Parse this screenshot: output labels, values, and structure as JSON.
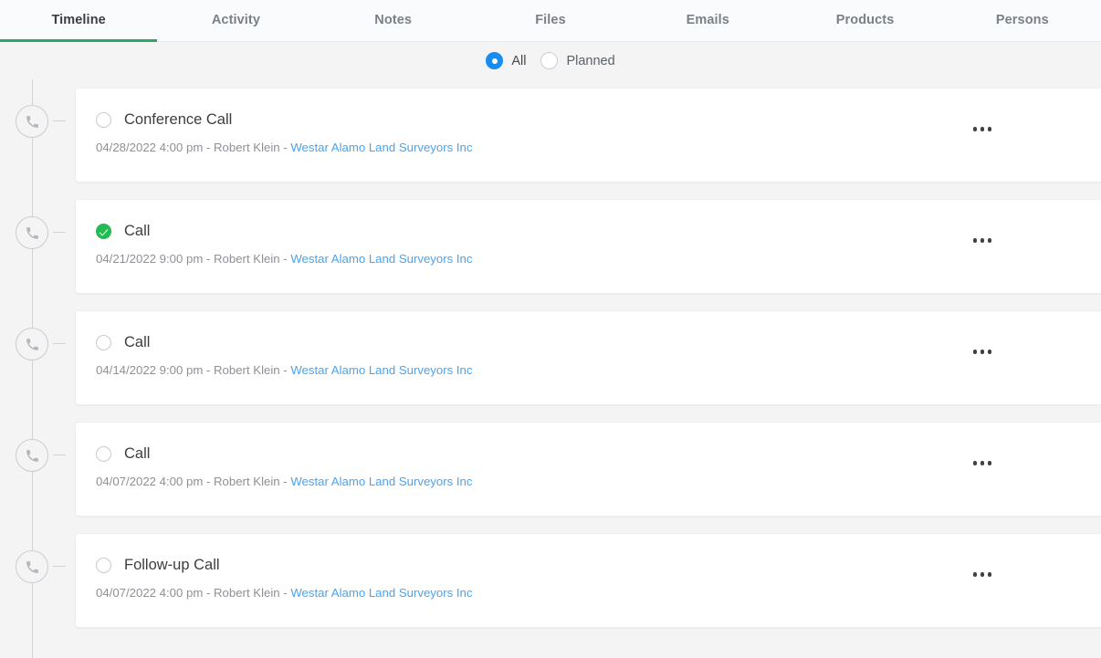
{
  "tabs": [
    {
      "label": "Timeline",
      "active": true
    },
    {
      "label": "Activity",
      "active": false
    },
    {
      "label": "Notes",
      "active": false
    },
    {
      "label": "Files",
      "active": false
    },
    {
      "label": "Emails",
      "active": false
    },
    {
      "label": "Products",
      "active": false
    },
    {
      "label": "Persons",
      "active": false
    }
  ],
  "filter": {
    "all_label": "All",
    "planned_label": "Planned",
    "selected": "All"
  },
  "colors": {
    "active_tab_underline": "#2ea664",
    "radio_selected": "#1a8cf0",
    "link": "#4aa3f0",
    "status_done": "#21ba53",
    "page_background": "#f4f4f4",
    "card_background": "#ffffff"
  },
  "timeline": {
    "icon": "phone-icon",
    "menu_icon": "kebab-menu-icon",
    "items": [
      {
        "title": "Conference Call",
        "status": "open",
        "date": "04/28/2022 4:00 pm",
        "owner": "Robert Klein",
        "company": "Westar Alamo Land Surveyors Inc",
        "subtitle": "04/28/2022 4:00 pm - Robert Klein - "
      },
      {
        "title": "Call",
        "status": "done",
        "date": "04/21/2022 9:00 pm",
        "owner": "Robert Klein",
        "company": "Westar Alamo Land Surveyors Inc",
        "subtitle": "04/21/2022 9:00 pm - Robert Klein - "
      },
      {
        "title": "Call",
        "status": "open",
        "date": "04/14/2022 9:00 pm",
        "owner": "Robert Klein",
        "company": "Westar Alamo Land Surveyors Inc",
        "subtitle": "04/14/2022 9:00 pm - Robert Klein - "
      },
      {
        "title": "Call",
        "status": "open",
        "date": "04/07/2022 4:00 pm",
        "owner": "Robert Klein",
        "company": "Westar Alamo Land Surveyors Inc",
        "subtitle": "04/07/2022 4:00 pm - Robert Klein - "
      },
      {
        "title": "Follow-up Call",
        "status": "open",
        "date": "04/07/2022 4:00 pm",
        "owner": "Robert Klein",
        "company": "Westar Alamo Land Surveyors Inc",
        "subtitle": "04/07/2022 4:00 pm - Robert Klein - "
      }
    ]
  }
}
